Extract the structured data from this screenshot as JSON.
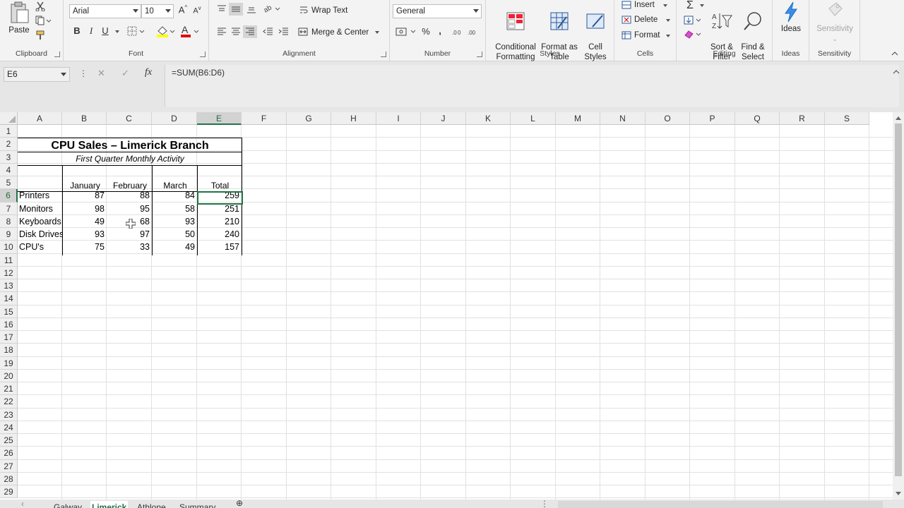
{
  "ribbon": {
    "clipboard": {
      "paste": "Paste",
      "label": "Clipboard"
    },
    "font": {
      "name": "Arial",
      "size": "10",
      "bold": "B",
      "italic": "I",
      "underline": "U",
      "label": "Font"
    },
    "alignment": {
      "wrap": "Wrap Text",
      "merge": "Merge & Center",
      "label": "Alignment"
    },
    "number": {
      "format": "General",
      "label": "Number"
    },
    "styles": {
      "conditional": "Conditional\nFormatting",
      "format_table": "Format as\nTable",
      "cell_styles": "Cell\nStyles",
      "label": "Styles"
    },
    "cells": {
      "insert": "Insert",
      "delete": "Delete",
      "format": "Format",
      "label": "Cells"
    },
    "editing": {
      "sort": "Sort &\nFilter",
      "find": "Find &\nSelect",
      "label": "Editing"
    },
    "ideas": {
      "button": "Ideas",
      "label": "Ideas"
    },
    "sensitivity": {
      "button": "Sensitivity",
      "label": "Sensitivity"
    }
  },
  "formula_bar": {
    "name_box": "E6",
    "fx": "fx",
    "formula": "=SUM(B6:D6)"
  },
  "columns": [
    "A",
    "B",
    "C",
    "D",
    "E",
    "F",
    "G",
    "H",
    "I",
    "J",
    "K",
    "L",
    "M",
    "N",
    "O",
    "P",
    "Q",
    "R",
    "S"
  ],
  "rows": [
    "1",
    "2",
    "3",
    "4",
    "5",
    "6",
    "7",
    "8",
    "9",
    "10",
    "11",
    "12",
    "13",
    "14",
    "15",
    "16",
    "17",
    "18",
    "19",
    "20",
    "21",
    "22",
    "23",
    "24",
    "25",
    "26",
    "27",
    "28",
    "29"
  ],
  "sheet": {
    "title": "CPU Sales – Limerick Branch",
    "subtitle": "First Quarter Monthly Activity",
    "headers": [
      "January",
      "February",
      "March",
      "Total"
    ],
    "data": [
      [
        "Printers",
        "87",
        "88",
        "84",
        "259"
      ],
      [
        "Monitors",
        "98",
        "95",
        "58",
        "251"
      ],
      [
        "Keyboards",
        "49",
        "68",
        "93",
        "210"
      ],
      [
        "Disk Drives",
        "93",
        "97",
        "50",
        "240"
      ],
      [
        "CPU's",
        "75",
        "33",
        "49",
        "157"
      ]
    ]
  },
  "tabs": [
    "Galway",
    "Limerick",
    "Athlone",
    "Summary"
  ],
  "active_tab": "Limerick",
  "colors": {
    "accent": "#217346"
  }
}
